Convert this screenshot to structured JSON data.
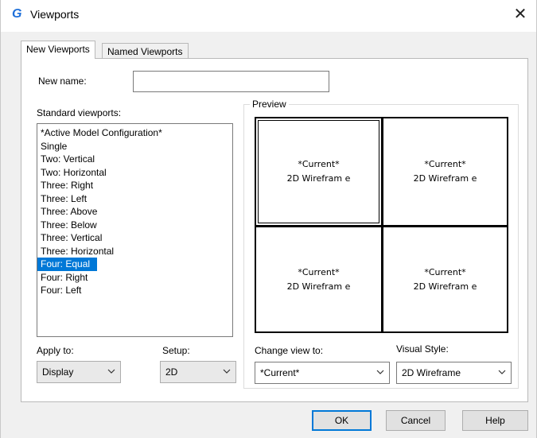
{
  "window": {
    "title": "Viewports",
    "icon": "app-logo-icon",
    "close_icon": "close-icon"
  },
  "tabs": [
    {
      "label": "New Viewports",
      "active": true
    },
    {
      "label": "Named Viewports",
      "active": false
    }
  ],
  "new_name": {
    "label": "New name:",
    "value": ""
  },
  "standard_viewports": {
    "label": "Standard viewports:",
    "items": [
      "*Active Model Configuration*",
      "Single",
      "Two:  Vertical",
      "Two:  Horizontal",
      "Three: Right",
      "Three: Left",
      "Three: Above",
      "Three: Below",
      "Three: Vertical",
      "Three: Horizontal",
      "Four:  Equal",
      "Four:  Right",
      "Four:  Left"
    ],
    "selected_index": 10
  },
  "preview": {
    "label": "Preview",
    "viewports": [
      {
        "view": "*Current*",
        "style": "2D Wirefram e"
      },
      {
        "view": "*Current*",
        "style": "2D Wirefram e"
      },
      {
        "view": "*Current*",
        "style": "2D Wirefram e"
      },
      {
        "view": "*Current*",
        "style": "2D Wirefram e"
      }
    ]
  },
  "apply_to": {
    "label": "Apply to:",
    "value": "Display"
  },
  "setup": {
    "label": "Setup:",
    "value": "2D"
  },
  "change_view_to": {
    "label": "Change view to:",
    "value": "*Current*"
  },
  "visual_style": {
    "label": "Visual Style:",
    "value": "2D Wireframe"
  },
  "buttons": {
    "ok": "OK",
    "cancel": "Cancel",
    "help": "Help"
  },
  "colors": {
    "selection": "#0078d7",
    "accent_border": "#0078d7",
    "app_icon": "#1e6fd9"
  }
}
